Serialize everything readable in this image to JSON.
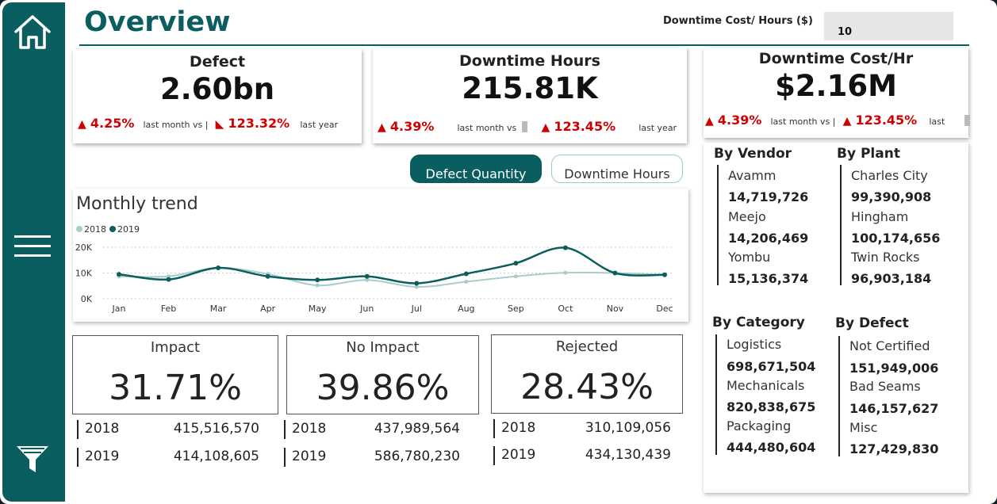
{
  "header": {
    "title": "Overview",
    "param_label": "Downtime Cost/ Hours ($)",
    "param_value": "10"
  },
  "sidebar": {
    "items": [
      {
        "icon": "home-icon"
      },
      {
        "icon": "menu-icon"
      },
      {
        "icon": "filter-icon"
      }
    ]
  },
  "kpis": {
    "defect": {
      "title": "Defect",
      "value": "2.60bn",
      "month_pct": "4.25%",
      "month_label": "last month vs |",
      "year_pct": "123.32%",
      "year_label": "last year"
    },
    "downtime_hours": {
      "title": "Downtime Hours",
      "value": "215.81K",
      "month_pct": "4.39%",
      "month_label": "last month vs",
      "year_pct": "123.45%",
      "year_label": "last year"
    },
    "downtime_cost": {
      "title": "Downtime Cost/Hr",
      "value": "$2.16M",
      "month_pct": "4.39%",
      "month_label": "last month vs |",
      "year_pct": "123.45%",
      "year_label": "last"
    }
  },
  "toggles": {
    "active": "Defect Quantity",
    "inactive": "Downtime Hours"
  },
  "colors": {
    "accent": "#0b5e5f",
    "series_2018": "#a8cccc",
    "series_2019": "#0b5e5f",
    "negative": "#d00000"
  },
  "chart_data": {
    "type": "line",
    "title": "Monthly trend",
    "categories": [
      "Jan",
      "Feb",
      "Mar",
      "Apr",
      "May",
      "Jun",
      "Jul",
      "Aug",
      "Sep",
      "Oct",
      "Nov",
      "Dec"
    ],
    "series": [
      {
        "name": "2018",
        "values": [
          8700,
          8700,
          12000,
          9600,
          5200,
          7300,
          4600,
          6600,
          8700,
          10100,
          10000,
          9300
        ]
      },
      {
        "name": "2019",
        "values": [
          9500,
          7500,
          12000,
          8700,
          7300,
          8700,
          6000,
          9700,
          13800,
          19800,
          10000,
          9300
        ]
      }
    ],
    "y_ticks": [
      "0K",
      "10K",
      "20K"
    ],
    "ylim": [
      0,
      20000
    ],
    "grid": true,
    "legend": "top-left"
  },
  "impact": [
    {
      "title": "Impact",
      "value": "31.71%",
      "rows": [
        {
          "year": "2018",
          "value": "415,516,570"
        },
        {
          "year": "2019",
          "value": "414,108,605"
        }
      ]
    },
    {
      "title": "No Impact",
      "value": "39.86%",
      "rows": [
        {
          "year": "2018",
          "value": "437,989,564"
        },
        {
          "year": "2019",
          "value": "586,780,230"
        }
      ]
    },
    {
      "title": "Rejected",
      "value": "28.43%",
      "rows": [
        {
          "year": "2018",
          "value": "310,109,056"
        },
        {
          "year": "2019",
          "value": "434,130,439"
        }
      ]
    }
  ],
  "breakdowns": {
    "vendor": {
      "title": "By Vendor",
      "items": [
        {
          "name": "Avamm",
          "value": "14,719,726"
        },
        {
          "name": "Meejo",
          "value": "14,206,469"
        },
        {
          "name": "Yombu",
          "value": "15,136,374"
        }
      ]
    },
    "plant": {
      "title": "By Plant",
      "items": [
        {
          "name": "Charles City",
          "value": "99,390,908"
        },
        {
          "name": "Hingham",
          "value": "100,174,656"
        },
        {
          "name": "Twin Rocks",
          "value": "96,903,184"
        }
      ]
    },
    "category": {
      "title": "By Category",
      "items": [
        {
          "name": "Logistics",
          "value": "698,671,504"
        },
        {
          "name": "Mechanicals",
          "value": "820,838,675"
        },
        {
          "name": "Packaging",
          "value": "444,480,604"
        }
      ]
    },
    "defect": {
      "title": "By Defect",
      "items": [
        {
          "name": "Not Certified",
          "value": "151,949,006"
        },
        {
          "name": "Bad Seams",
          "value": "146,157,627"
        },
        {
          "name": "Misc",
          "value": "127,429,830"
        }
      ]
    }
  }
}
